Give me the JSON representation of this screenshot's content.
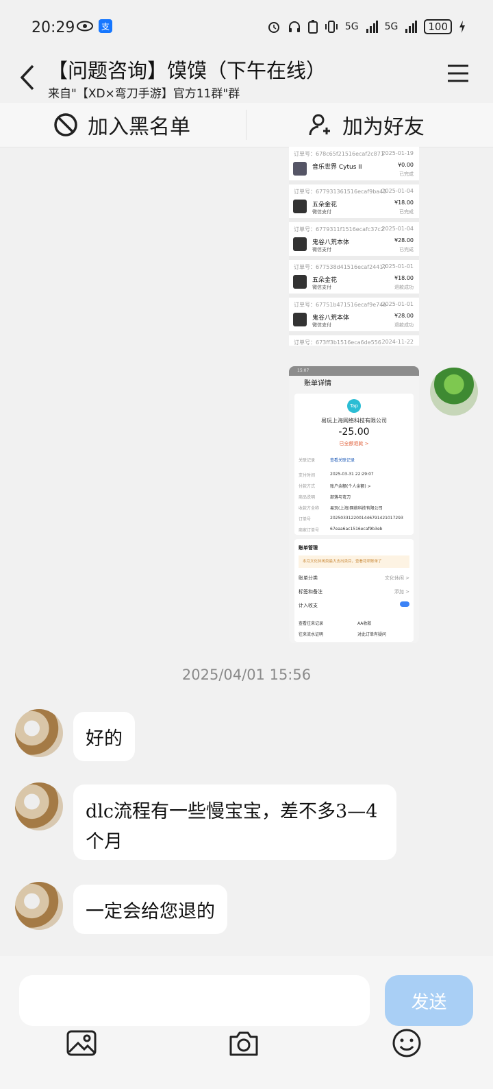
{
  "status_bar": {
    "time": "20:29",
    "network1": "5G",
    "network2": "5G",
    "battery": "100"
  },
  "header": {
    "title": "【问题咨询】馍馍（下午在线）",
    "subtitle": "来自\"【XD×弯刀手游】官方11群\"群"
  },
  "actions": {
    "blacklist": "加入黑名单",
    "add_friend": "加为好友"
  },
  "order_screenshot": {
    "orders": [
      {
        "num": "订单号：678c65f21516ecaf2c871",
        "date": "2025-01-19",
        "game": "音乐世界 Cytus II",
        "pay": "",
        "price": "¥0.00",
        "state": "已完成"
      },
      {
        "num": "订单号：677931361516ecaf9ba43",
        "date": "2025-01-04",
        "game": "五朵金花",
        "pay": "微信支付",
        "price": "¥18.00",
        "state": "已完成"
      },
      {
        "num": "订单号：6779311f1516ecafc37c2",
        "date": "2025-01-04",
        "game": "鬼谷八荒本体",
        "pay": "微信支付",
        "price": "¥28.00",
        "state": "已完成"
      },
      {
        "num": "订单号：677538d41516ecaf24417",
        "date": "2025-01-01",
        "game": "五朵金花",
        "pay": "微信支付",
        "price": "¥18.00",
        "state": "退款成功"
      },
      {
        "num": "订单号：67751b471516ecaf9e74a",
        "date": "2025-01-01",
        "game": "鬼谷八荒本体",
        "pay": "微信支付",
        "price": "¥28.00",
        "state": "退款成功"
      },
      {
        "num": "订单号：673ff3b1516eca6de556",
        "date": "2024-11-22",
        "game": "",
        "pay": "",
        "price": "",
        "state": ""
      }
    ]
  },
  "bill_screenshot": {
    "statusbar_time": "15:07",
    "nav_title": "账单详情",
    "logo_text": "Tap",
    "merchant": "易玩上海网络科技有限公司",
    "amount": "-25.00",
    "refund_status": "已全额退款 >",
    "related_label": "关联记录",
    "related_value": "查看关联记录",
    "rows": [
      {
        "label": "支付时间",
        "value": "2025-03-31 22:29:07"
      },
      {
        "label": "付款方式",
        "value": "账户余额(个人余额) >"
      },
      {
        "label": "商品说明",
        "value": "部落与弯刀"
      },
      {
        "label": "收款方全称",
        "value": "易玩(上海)网络科技有限公司"
      },
      {
        "label": "订单号",
        "value": "2025033122001446791421017293"
      },
      {
        "label": "商家订单号",
        "value": "67eaa6ac1516ecaf9b3eb"
      }
    ],
    "mgmt_title": "账单管理",
    "mgmt_banner": "本月文化休闲类最大支出类目，查看花呗账单了",
    "category_label": "账单分类",
    "category_value": "文化休闲 >",
    "tags_label": "标签和备注",
    "tags_value": "添加 >",
    "income_label": "计入收支",
    "link1": "查看往来记录",
    "link2": "AA收款",
    "link3": "往来流水证明",
    "link4": "对此订单有疑问"
  },
  "timestamp": "2025/04/01 15:56",
  "messages": [
    {
      "text": "好的"
    },
    {
      "text": "dlc流程有一些慢宝宝，差不多3—4个月"
    },
    {
      "text": "一定会给您退的"
    }
  ],
  "composer": {
    "placeholder": "",
    "send": "发送"
  },
  "colors": {
    "send_button": "#a9cff5",
    "refund_text": "#e0603b",
    "tap_logo": "#2bbdd4"
  }
}
